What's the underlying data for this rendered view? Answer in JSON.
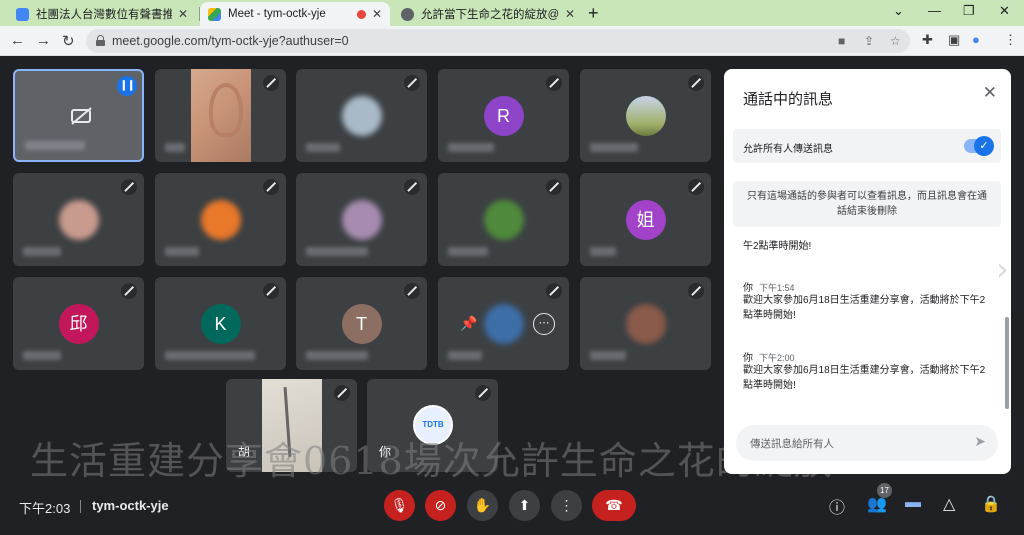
{
  "browser": {
    "tabs": [
      {
        "label": "社團法人台灣數位有聲書推展學",
        "favicon_color": "#4285f4",
        "active": false
      },
      {
        "label": "Meet - tym-octk-yje",
        "favicon_color": "#34a853",
        "active": true
      },
      {
        "label": "允許當下生命之花的綻放@本年",
        "favicon_color": "#5f6368",
        "active": false
      }
    ],
    "new_tab_label": "+",
    "window_controls": [
      "⌄",
      "—",
      "❐",
      "✕"
    ],
    "url": "meet.google.com/tym-octk-yje?authuser=0"
  },
  "grid": {
    "row1": [
      {
        "type": "cam-off",
        "speaking": true
      },
      {
        "type": "video-ear"
      },
      {
        "type": "blurred-avatar",
        "color": "#a9b9c8"
      },
      {
        "type": "letter",
        "letter": "R",
        "color": "#8e44c9"
      },
      {
        "type": "photo-avatar",
        "color": "#9fb06a"
      }
    ],
    "row2": [
      {
        "type": "blurred-avatar",
        "color": "#c99a8e"
      },
      {
        "type": "blurred-avatar",
        "color": "#e8782a"
      },
      {
        "type": "blurred-avatar",
        "color": "#a88bb0"
      },
      {
        "type": "blurred-avatar",
        "color": "#4f8a3c"
      },
      {
        "type": "letter",
        "letter": "姐",
        "color": "#a142c9"
      }
    ],
    "row3": [
      {
        "type": "letter",
        "letter": "邱",
        "color": "#c2185b"
      },
      {
        "type": "letter",
        "letter": "K",
        "color": "#00695c"
      },
      {
        "type": "letter",
        "letter": "T",
        "color": "#8d6e63"
      },
      {
        "type": "hover",
        "color": "#3d6ea8"
      },
      {
        "type": "blurred-avatar",
        "color": "#8a5a4a"
      }
    ],
    "row4": [
      {
        "type": "video-pen",
        "name": "胡"
      },
      {
        "type": "tdtb",
        "name": "你",
        "logo": "TDTB"
      }
    ]
  },
  "caption": "生活重建分享會0618場次允許生命之花的綻放",
  "chat": {
    "title": "通話中的訊息",
    "allow_label": "允許所有人傳送訊息",
    "allow_enabled": true,
    "notice": "只有這場通話的參與者可以查看訊息，而且訊息會在通話結束後刪除",
    "partial_message": "午2點準時開始!",
    "messages": [
      {
        "sender": "你",
        "time": "下午1:54",
        "text": "歡迎大家參加6月18日生活重建分享會，活動將於下午2點準時開始!"
      },
      {
        "sender": "你",
        "time": "下午2:00",
        "text": "歡迎大家參加6月18日生活重建分享會，活動將於下午2點準時開始!"
      }
    ],
    "input_placeholder": "傳送訊息給所有人"
  },
  "bottom": {
    "time": "下午2:03",
    "meeting_code": "tym-octk-yje",
    "participant_count": "17"
  },
  "icons": {
    "mic_off": "mic-off-icon",
    "camera_off": "camera-off-icon",
    "raise_hand": "raise-hand-icon",
    "present": "present-icon",
    "more": "more-vert-icon",
    "end_call": "end-call-icon",
    "info": "info-icon",
    "people": "people-icon",
    "chat": "chat-icon",
    "activities": "activities-icon",
    "host_controls": "host-controls-icon"
  }
}
